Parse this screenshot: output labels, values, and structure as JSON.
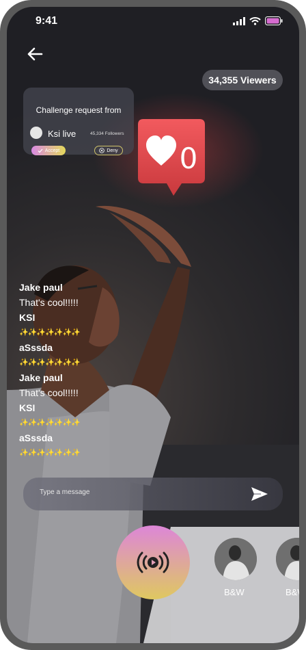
{
  "status_bar": {
    "time": "9:41"
  },
  "viewers": {
    "label": "34,355 Viewers"
  },
  "challenge": {
    "title": "Challenge request from",
    "user_name": "Ksi live",
    "followers": "45,334 Followers",
    "accept_label": "Accept",
    "deny_label": "Deny"
  },
  "like_badge": {
    "count": "0"
  },
  "chat": {
    "messages": [
      {
        "name": "Jake paul",
        "text": "That's cool!!!!!"
      },
      {
        "name": "KSI",
        "text": "✨✨✨✨✨✨✨"
      },
      {
        "name": "aSssda",
        "text": "✨✨✨✨✨✨✨"
      },
      {
        "name": "Jake paul",
        "text": "That's cool!!!!!"
      },
      {
        "name": "KSI",
        "text": "✨✨✨✨✨✨✨"
      },
      {
        "name": "aSssda",
        "text": "✨✨✨✨✨✨✨"
      }
    ]
  },
  "message_input": {
    "placeholder": "Type a message"
  },
  "filters": [
    {
      "label": "B&W"
    },
    {
      "label": "B&W"
    }
  ],
  "colors": {
    "accent_pink": "#dd86d8",
    "accent_yellow": "#dfc860",
    "like_red": "#e0454a"
  }
}
